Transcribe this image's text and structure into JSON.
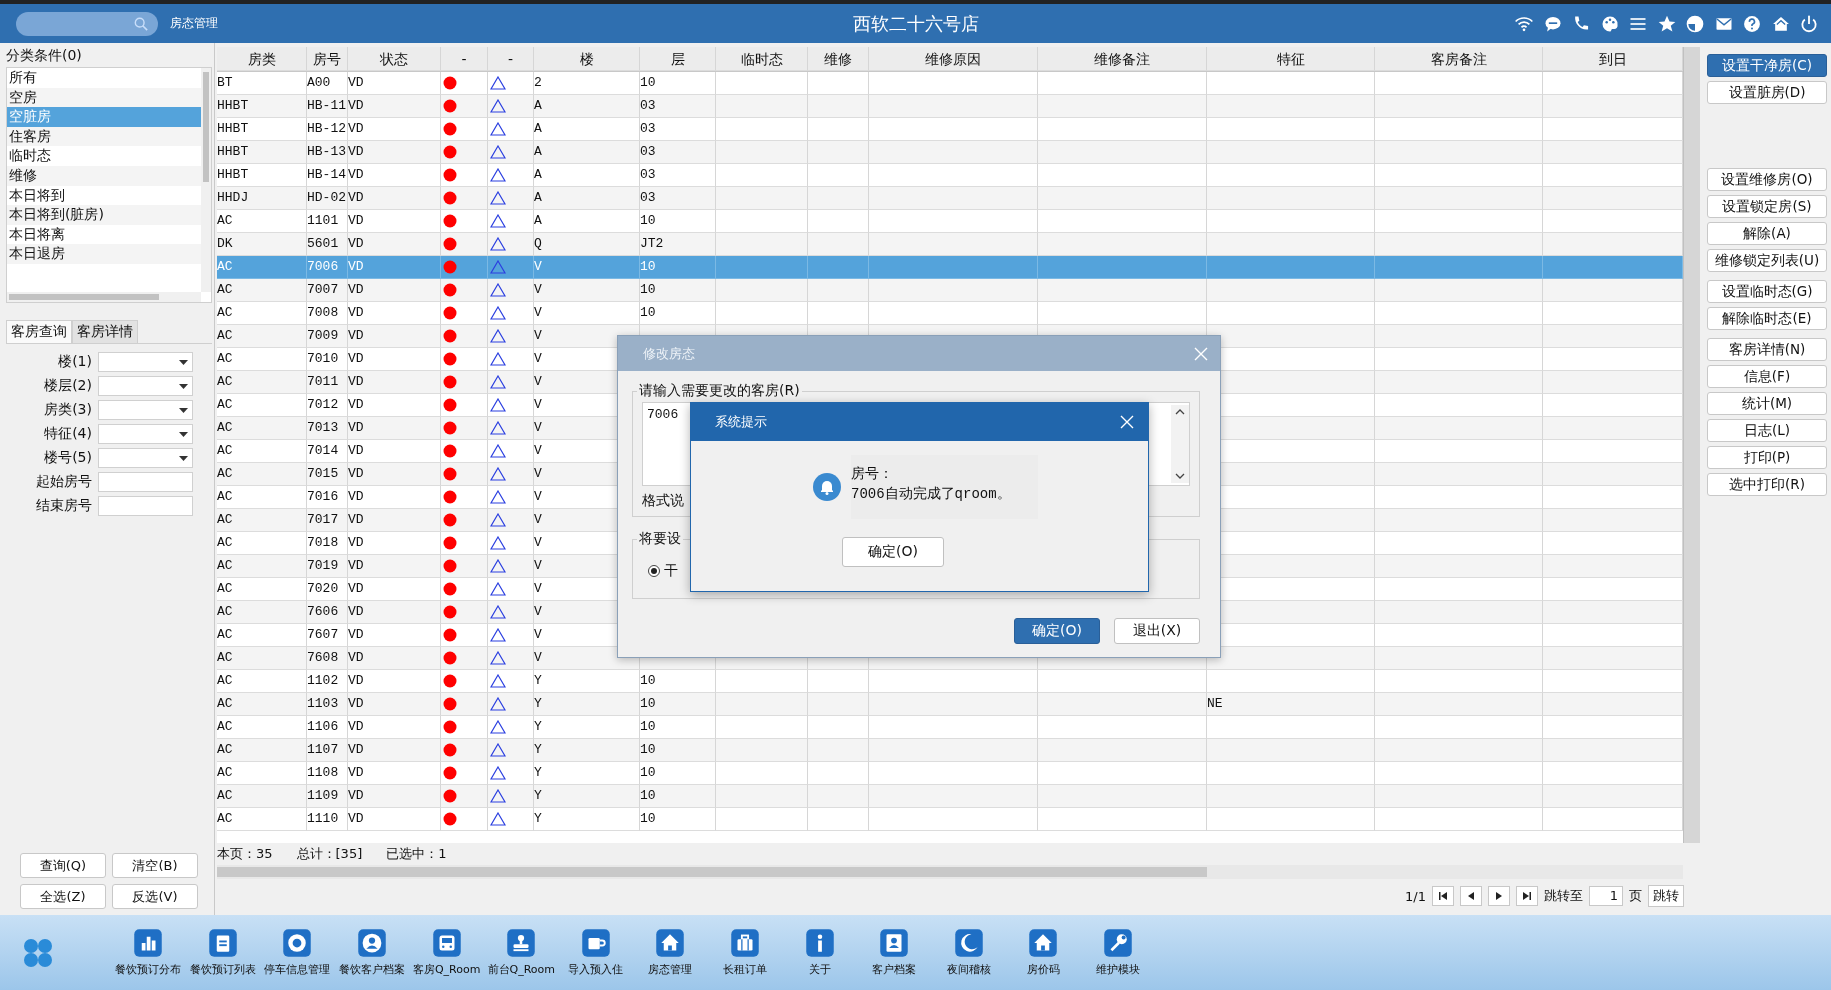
{
  "header": {
    "module": "房态管理",
    "title": "西软二十六号店"
  },
  "categories": {
    "label": "分类条件(0)",
    "items": [
      {
        "label": "所有",
        "selected": false
      },
      {
        "label": "空房",
        "selected": false
      },
      {
        "label": "空脏房",
        "selected": true
      },
      {
        "label": "住客房",
        "selected": false
      },
      {
        "label": "临时态",
        "selected": false
      },
      {
        "label": "维修",
        "selected": false
      },
      {
        "label": "本日将到",
        "selected": false
      },
      {
        "label": "本日将到(脏房)",
        "selected": false
      },
      {
        "label": "本日将离",
        "selected": false
      },
      {
        "label": "本日退房",
        "selected": false
      }
    ]
  },
  "query_tabs": [
    {
      "label": "客房查询",
      "selected": true
    },
    {
      "label": "客房详情",
      "selected": false
    }
  ],
  "filters": [
    {
      "label": "楼(1)",
      "kind": "dropdown"
    },
    {
      "label": "楼层(2)",
      "kind": "dropdown"
    },
    {
      "label": "房类(3)",
      "kind": "dropdown"
    },
    {
      "label": "特征(4)",
      "kind": "dropdown"
    },
    {
      "label": "楼号(5)",
      "kind": "dropdown"
    },
    {
      "label": "起始房号",
      "kind": "text"
    },
    {
      "label": "结束房号",
      "kind": "text"
    }
  ],
  "left_buttons": [
    "查询(Q)",
    "清空(B)",
    "全选(Z)",
    "反选(V)"
  ],
  "table": {
    "columns": [
      "房类",
      "房号",
      "状态",
      "-",
      "-",
      "楼",
      "层",
      "临时态",
      "维修",
      "维修原因",
      "维修备注",
      "特征",
      "客房备注",
      "到日"
    ],
    "rows": [
      {
        "type": "BT",
        "room": "A00",
        "status": "VD",
        "building": "2",
        "floor": "10",
        "selected": false
      },
      {
        "type": "HHBT",
        "room": "HB-11",
        "status": "VD",
        "building": "A",
        "floor": "03",
        "selected": false
      },
      {
        "type": "HHBT",
        "room": "HB-12",
        "status": "VD",
        "building": "A",
        "floor": "03",
        "selected": false
      },
      {
        "type": "HHBT",
        "room": "HB-13",
        "status": "VD",
        "building": "A",
        "floor": "03",
        "selected": false
      },
      {
        "type": "HHBT",
        "room": "HB-14",
        "status": "VD",
        "building": "A",
        "floor": "03",
        "selected": false
      },
      {
        "type": "HHDJ",
        "room": "HD-02",
        "status": "VD",
        "building": "A",
        "floor": "03",
        "selected": false
      },
      {
        "type": "AC",
        "room": "1101",
        "status": "VD",
        "building": "A",
        "floor": "10",
        "selected": false
      },
      {
        "type": "DK",
        "room": "5601",
        "status": "VD",
        "building": "Q",
        "floor": "JT2",
        "selected": false
      },
      {
        "type": "AC",
        "room": "7006",
        "status": "VD",
        "building": "V",
        "floor": "10",
        "selected": true
      },
      {
        "type": "AC",
        "room": "7007",
        "status": "VD",
        "building": "V",
        "floor": "10",
        "selected": false
      },
      {
        "type": "AC",
        "room": "7008",
        "status": "VD",
        "building": "V",
        "floor": "10",
        "selected": false
      },
      {
        "type": "AC",
        "room": "7009",
        "status": "VD",
        "building": "V",
        "selected": false
      },
      {
        "type": "AC",
        "room": "7010",
        "status": "VD",
        "building": "V",
        "selected": false
      },
      {
        "type": "AC",
        "room": "7011",
        "status": "VD",
        "building": "V",
        "selected": false
      },
      {
        "type": "AC",
        "room": "7012",
        "status": "VD",
        "building": "V",
        "selected": false
      },
      {
        "type": "AC",
        "room": "7013",
        "status": "VD",
        "building": "V",
        "selected": false
      },
      {
        "type": "AC",
        "room": "7014",
        "status": "VD",
        "building": "V",
        "selected": false
      },
      {
        "type": "AC",
        "room": "7015",
        "status": "VD",
        "building": "V",
        "selected": false
      },
      {
        "type": "AC",
        "room": "7016",
        "status": "VD",
        "building": "V",
        "selected": false
      },
      {
        "type": "AC",
        "room": "7017",
        "status": "VD",
        "building": "V",
        "selected": false
      },
      {
        "type": "AC",
        "room": "7018",
        "status": "VD",
        "building": "V",
        "selected": false
      },
      {
        "type": "AC",
        "room": "7019",
        "status": "VD",
        "building": "V",
        "selected": false
      },
      {
        "type": "AC",
        "room": "7020",
        "status": "VD",
        "building": "V",
        "selected": false
      },
      {
        "type": "AC",
        "room": "7606",
        "status": "VD",
        "building": "V",
        "selected": false
      },
      {
        "type": "AC",
        "room": "7607",
        "status": "VD",
        "building": "V",
        "selected": false
      },
      {
        "type": "AC",
        "room": "7608",
        "status": "VD",
        "building": "V",
        "selected": false
      },
      {
        "type": "AC",
        "room": "1102",
        "status": "VD",
        "building": "Y",
        "floor": "10",
        "selected": false
      },
      {
        "type": "AC",
        "room": "1103",
        "status": "VD",
        "building": "Y",
        "floor": "10",
        "feature": "NE",
        "selected": false
      },
      {
        "type": "AC",
        "room": "1106",
        "status": "VD",
        "building": "Y",
        "floor": "10",
        "selected": false
      },
      {
        "type": "AC",
        "room": "1107",
        "status": "VD",
        "building": "Y",
        "floor": "10",
        "selected": false
      },
      {
        "type": "AC",
        "room": "1108",
        "status": "VD",
        "building": "Y",
        "floor": "10",
        "selected": false
      },
      {
        "type": "AC",
        "room": "1109",
        "status": "VD",
        "building": "Y",
        "floor": "10",
        "selected": false
      },
      {
        "type": "AC",
        "room": "1110",
        "status": "VD",
        "building": "Y",
        "floor": "10",
        "selected": false
      }
    ]
  },
  "summary": {
    "page_count": "本页：35",
    "total": "总计：[35]",
    "selected_count": "已选中：1"
  },
  "pager": {
    "page": "1/1",
    "jump_label": "跳转至",
    "page_input": "1",
    "page_unit": "页",
    "jump_button": "跳转"
  },
  "actions": [
    [
      {
        "label": "设置干净房(C)",
        "selected": true
      },
      {
        "label": "设置脏房(D)",
        "selected": false
      }
    ],
    [
      {
        "label": "设置维修房(O)",
        "selected": false
      },
      {
        "label": "设置锁定房(S)",
        "selected": false
      },
      {
        "label": "解除(A)",
        "selected": false
      },
      {
        "label": "维修锁定列表(U)",
        "selected": false
      }
    ],
    [
      {
        "label": "设置临时态(G)",
        "selected": false
      },
      {
        "label": "解除临时态(E)",
        "selected": false
      }
    ],
    [
      {
        "label": "客房详情(N)",
        "selected": false
      },
      {
        "label": "信息(F)",
        "selected": false
      },
      {
        "label": "统计(M)",
        "selected": false
      },
      {
        "label": "日志(L)",
        "selected": false
      },
      {
        "label": "打印(P)",
        "selected": false
      },
      {
        "label": "选中打印(R)",
        "selected": false
      }
    ]
  ],
  "dialog": {
    "title": "修改房态",
    "room_group": "请输入需要更改的客房(R)",
    "room_input": "7006",
    "format_note": "格式说",
    "status_group": "将要设",
    "options": [
      {
        "label": "干",
        "selected": true
      }
    ],
    "buttons": [
      {
        "label": "确定(O)",
        "kind": "primary"
      },
      {
        "label": "退出(X)",
        "kind": "secondary"
      }
    ]
  },
  "alert": {
    "title": "系统提示",
    "lines": [
      "房号：",
      "7006自动完成了qroom。"
    ],
    "button": "确定(O)"
  },
  "taskbar": [
    {
      "label": "餐饮预订分布",
      "kind": "chart"
    },
    {
      "label": "餐饮预订列表",
      "kind": "clipboard"
    },
    {
      "label": "停车信息管理",
      "kind": "ring"
    },
    {
      "label": "餐饮客户档案",
      "kind": "person"
    },
    {
      "label": "客房Q_Room",
      "kind": "bus"
    },
    {
      "label": "前台Q_Room",
      "kind": "stamp"
    },
    {
      "label": "导入预入住",
      "kind": "cup"
    },
    {
      "label": "房态管理",
      "kind": "home"
    },
    {
      "label": "长租订单",
      "kind": "suitcase"
    },
    {
      "label": "关于",
      "kind": "info"
    },
    {
      "label": "客户档案",
      "kind": "badge"
    },
    {
      "label": "夜间稽核",
      "kind": "moon"
    },
    {
      "label": "房价码",
      "kind": "home"
    },
    {
      "label": "维护模块",
      "kind": "wrench"
    }
  ]
}
